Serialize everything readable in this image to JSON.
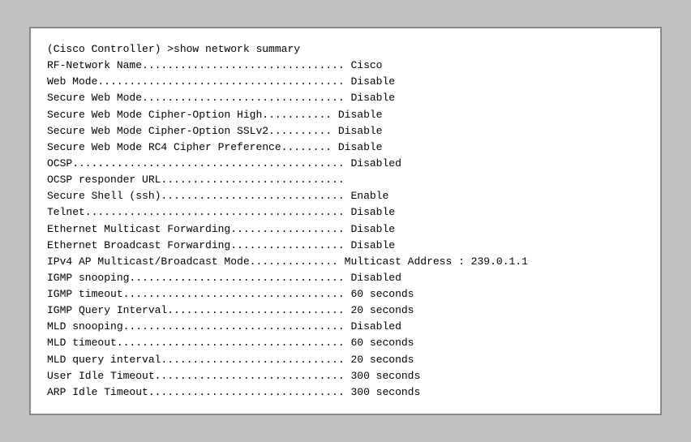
{
  "terminal": {
    "lines": [
      {
        "text": "(Cisco Controller) >show network summary",
        "bold": false
      },
      {
        "text": "RF-Network Name................................ Cisco",
        "bold": false
      },
      {
        "text": "Web Mode....................................... Disable",
        "bold": false
      },
      {
        "text": "Secure Web Mode................................ Disable",
        "bold": false
      },
      {
        "text": "Secure Web Mode Cipher-Option High........... Disable",
        "bold": false
      },
      {
        "text": "Secure Web Mode Cipher-Option SSLv2.......... Disable",
        "bold": false
      },
      {
        "text": "Secure Web Mode RC4 Cipher Preference........ Disable",
        "bold": false
      },
      {
        "text": "OCSP........................................... Disabled",
        "bold": false
      },
      {
        "text": "OCSP responder URL.............................",
        "bold": false
      },
      {
        "text": "Secure Shell (ssh)............................. Enable",
        "bold": false
      },
      {
        "text": "Telnet......................................... Disable",
        "bold": false
      },
      {
        "text": "Ethernet Multicast Forwarding.................. Disable",
        "bold": false
      },
      {
        "text": "Ethernet Broadcast Forwarding.................. Disable",
        "bold": false
      },
      {
        "text": "IPv4 AP Multicast/Broadcast Mode.............. Multicast Address : 239.0.1.1",
        "bold": false
      },
      {
        "text": "IGMP snooping.................................. Disabled",
        "bold": false
      },
      {
        "text": "IGMP timeout................................... 60 seconds",
        "bold": false
      },
      {
        "text": "IGMP Query Interval............................ 20 seconds",
        "bold": false
      },
      {
        "text": "MLD snooping................................... Disabled",
        "bold": false
      },
      {
        "text": "MLD timeout.................................... 60 seconds",
        "bold": false
      },
      {
        "text": "MLD query interval............................. 20 seconds",
        "bold": false
      },
      {
        "text": "User Idle Timeout.............................. 300 seconds",
        "bold": false
      },
      {
        "text": "ARP Idle Timeout............................... 300 seconds",
        "bold": false
      }
    ]
  }
}
